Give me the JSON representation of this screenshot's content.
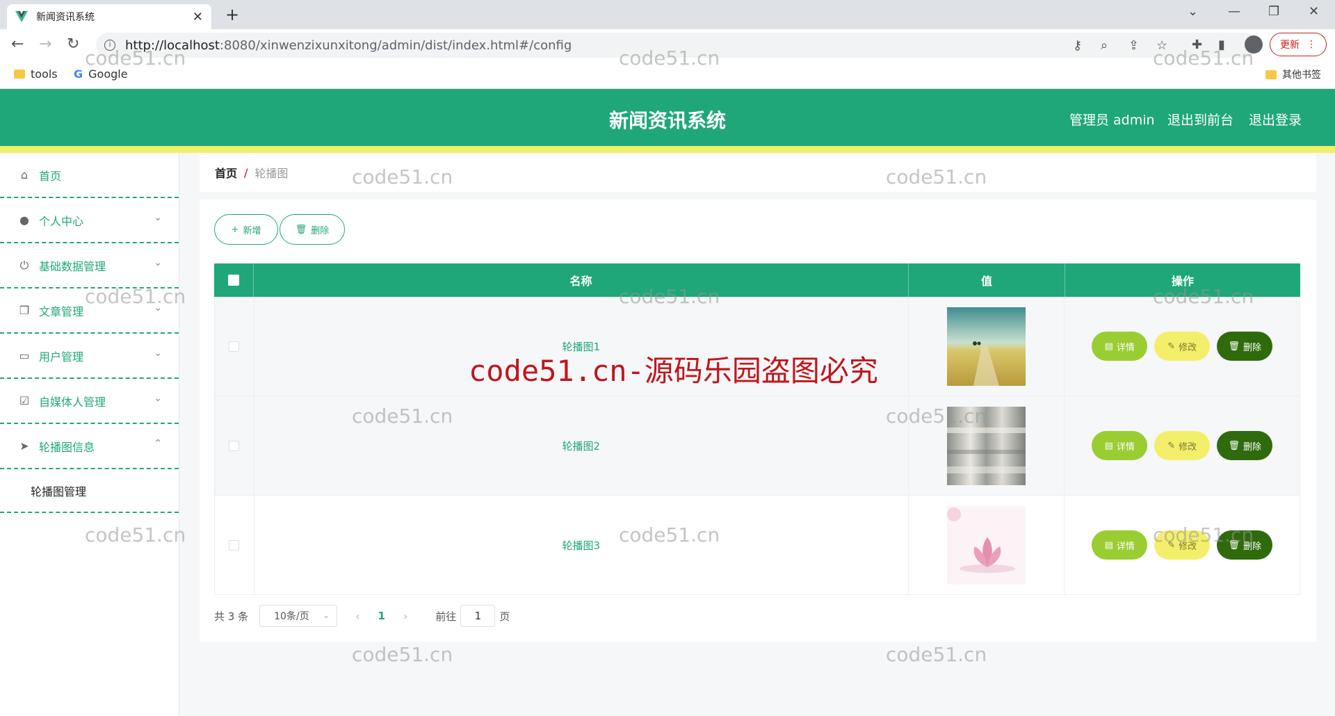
{
  "browser": {
    "tab_title": "新闻资讯系统",
    "url_host": "http://localhost",
    "url_rest": ":8080/xinwenzixunxitong/admin/dist/index.html#/config",
    "update_label": "更新",
    "bookmarks": [
      {
        "label": "tools"
      },
      {
        "label": "Google"
      }
    ],
    "other_bookmarks": "其他书签"
  },
  "header": {
    "title": "新闻资讯系统",
    "user": "管理员 admin",
    "to_front": "退出到前台",
    "logout": "退出登录"
  },
  "sidebar": {
    "items": [
      {
        "label": "首页",
        "icon": "home-icon"
      },
      {
        "label": "个人中心",
        "icon": "user-icon"
      },
      {
        "label": "基础数据管理",
        "icon": "power-icon"
      },
      {
        "label": "文章管理",
        "icon": "copy-icon"
      },
      {
        "label": "用户管理",
        "icon": "card-icon"
      },
      {
        "label": "自媒体人管理",
        "icon": "checkbox-icon"
      },
      {
        "label": "轮播图信息",
        "icon": "send-icon"
      }
    ],
    "sub_item": "轮播图管理"
  },
  "breadcrumb": {
    "home": "首页",
    "sep": "/",
    "current": "轮播图"
  },
  "toolbar": {
    "add_label": "新增",
    "delete_label": "删除"
  },
  "table": {
    "headers": [
      "名称",
      "值",
      "操作"
    ],
    "rows": [
      {
        "name": "轮播图1",
        "image": "field-road-image"
      },
      {
        "name": "轮播图2",
        "image": "abstract-texture-image"
      },
      {
        "name": "轮播图3",
        "image": "lotus-flower-image"
      }
    ],
    "actions": {
      "detail": "详情",
      "edit": "修改",
      "delete": "删除"
    }
  },
  "pager": {
    "total": "共 3 条",
    "page_size": "10条/页",
    "current_page": "1",
    "goto_prefix": "前往",
    "goto_value": "1",
    "goto_suffix": "页"
  },
  "watermark": {
    "small": "code51.cn",
    "big": "code51.cn-源码乐园盗图必究"
  },
  "colors": {
    "primary": "#1fa77a",
    "accent_yellow": "#f4ef6a",
    "detail_green": "#9acd32",
    "delete_dark": "#2f6b0c"
  }
}
